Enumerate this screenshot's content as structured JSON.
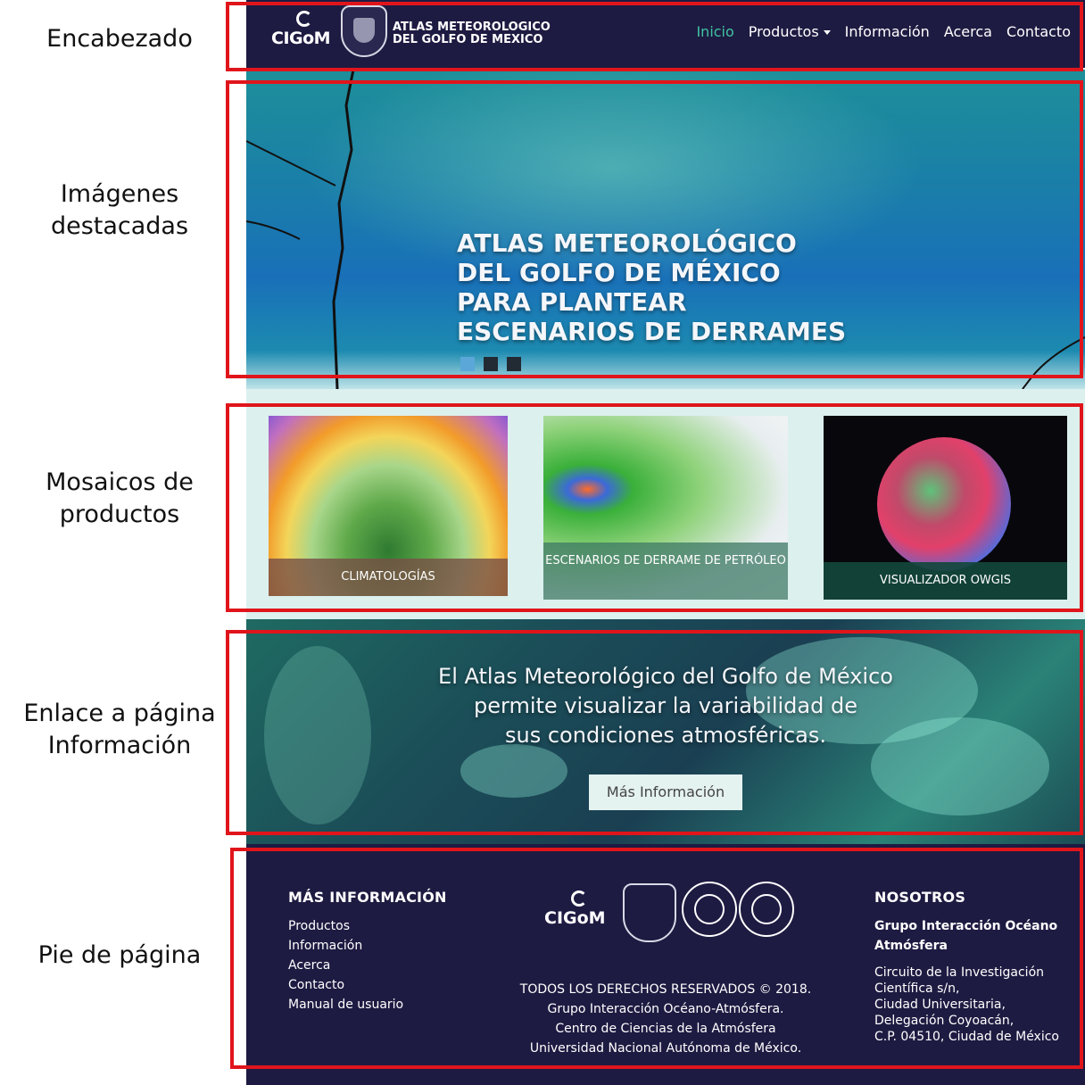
{
  "annotations": {
    "header": "Encabezado",
    "hero": [
      "Imágenes",
      "destacadas"
    ],
    "tiles": [
      "Mosaicos de",
      "productos"
    ],
    "info": [
      "Enlace a página",
      "Información"
    ],
    "footer": "Pie de página"
  },
  "header": {
    "logo_text": "CIGoM",
    "site_title_line1": "ATLAS METEOROLOGICO",
    "site_title_line2": "DEL GOLFO DE MEXICO",
    "nav": [
      "Inicio",
      "Productos",
      "Información",
      "Acerca",
      "Contacto"
    ],
    "active_nav": "Inicio"
  },
  "hero": {
    "heading": "ATLAS METEOROLÓGICO DEL GOLFO DE MÉXICO PARA PLANTEAR ESCENARIOS DE DERRAMES",
    "slides": 3,
    "active_slide": 1
  },
  "tiles": [
    {
      "label": "CLIMATOLOGÍAS"
    },
    {
      "label": "ESCENARIOS DE DERRAME DE PETRÓLEO"
    },
    {
      "label": "VISUALIZADOR OWGIS"
    }
  ],
  "info": {
    "text_line1": "El Atlas Meteorológico del Golfo de México",
    "text_line2": "permite visualizar la variabilidad de",
    "text_line3": "sus condiciones atmosféricas.",
    "button": "Más Información"
  },
  "footer": {
    "left_title": "MÁS INFORMACIÓN",
    "left_links": [
      "Productos",
      "Información",
      "Acerca",
      "Contacto",
      "Manual de usuario"
    ],
    "logo_text": "CIGoM",
    "legal": [
      "TODOS LOS DERECHOS RESERVADOS © 2018.",
      "Grupo Interacción Océano-Atmósfera.",
      "Centro de Ciencias de la Atmósfera",
      "Universidad Nacional Autónoma de México."
    ],
    "right_title": "NOSOTROS",
    "group": "Grupo Interacción Océano Atmósfera",
    "address": [
      "Circuito de la Investigación",
      "Científica s/n,",
      "Ciudad Universitaria,",
      "Delegación Coyoacán,",
      "C.P. 04510, Ciudad de México"
    ]
  },
  "colors": {
    "header_bg": "#1e1b42",
    "active_nav": "#3fc3a1",
    "annotation_frame": "#e0151b",
    "tiles_bg": "#dcf0ee"
  }
}
